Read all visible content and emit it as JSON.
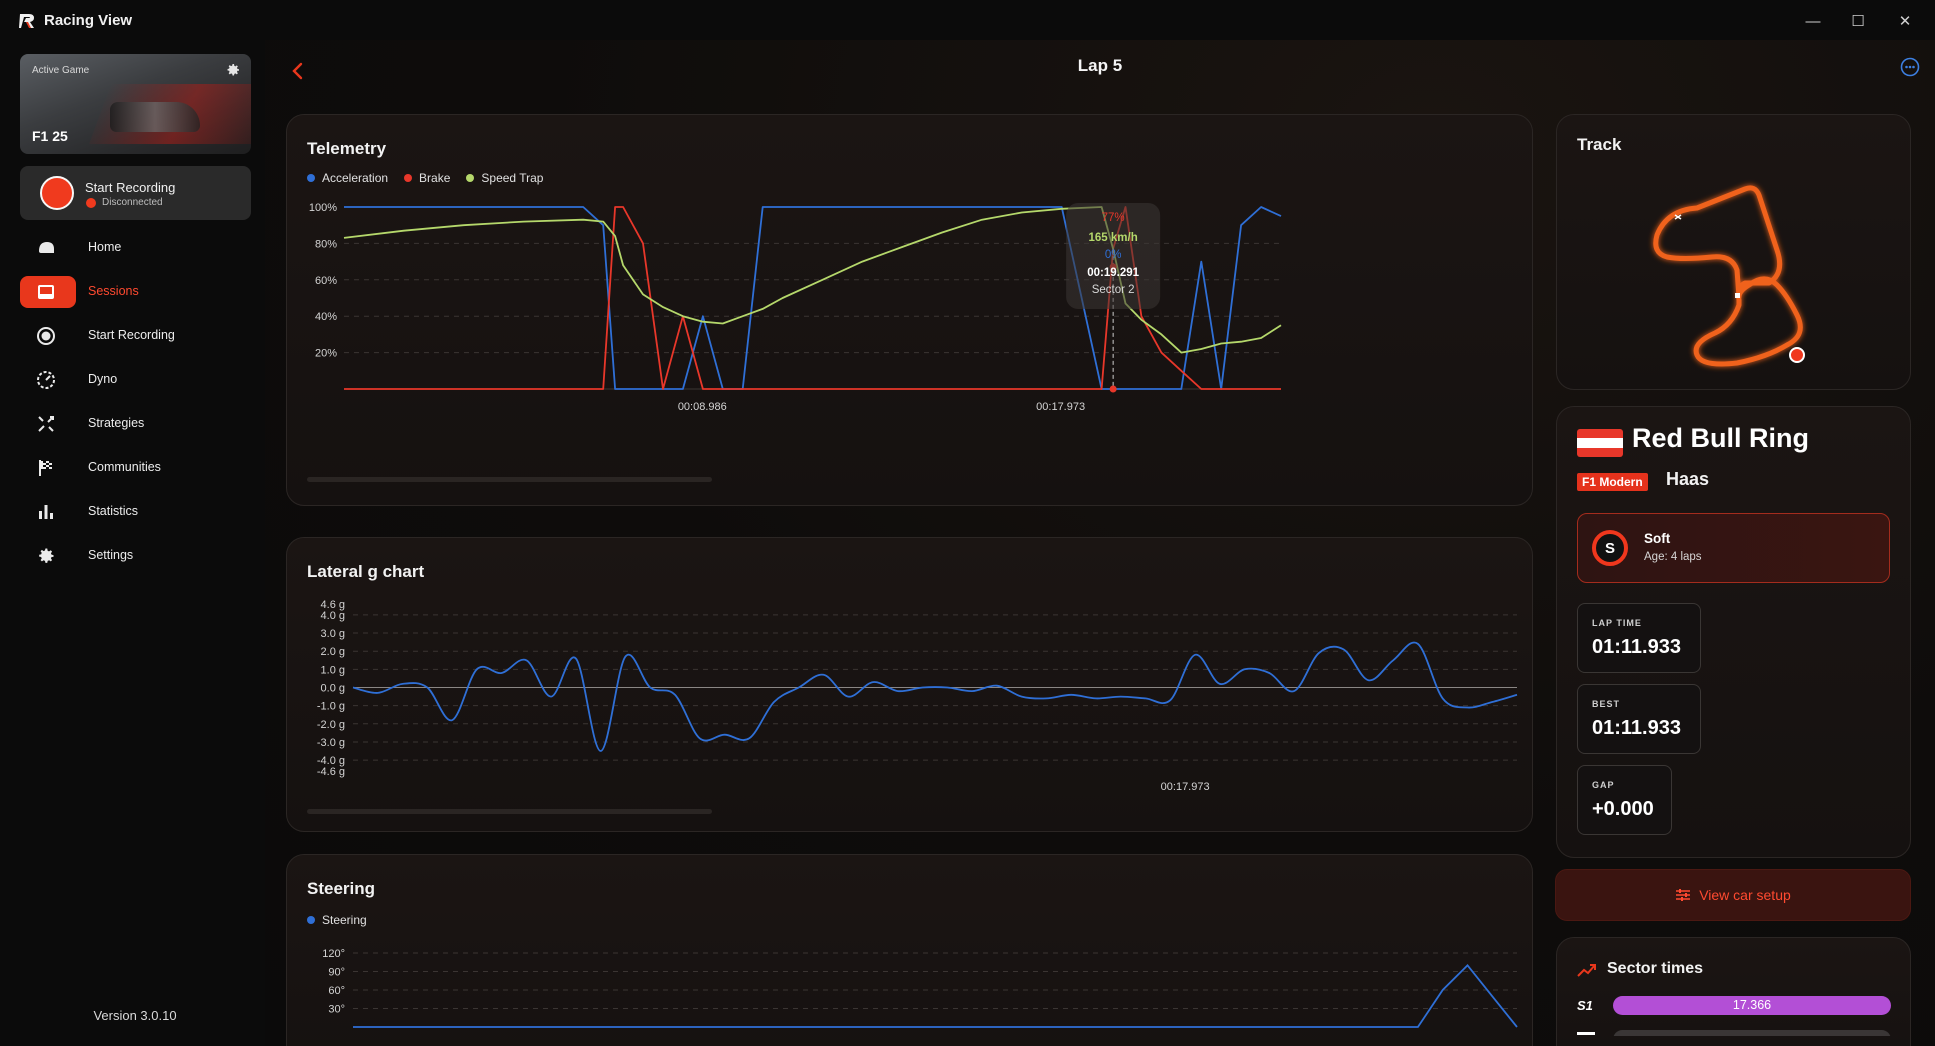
{
  "window": {
    "title": "Racing View",
    "minimize": "—",
    "maximize": "☐",
    "close": "✕"
  },
  "sidebar": {
    "active_game": {
      "label": "Active Game",
      "name": "F1 25"
    },
    "recording": {
      "title": "Start Recording",
      "status": "Disconnected"
    },
    "nav": [
      {
        "label": "Home",
        "icon": "helmet-icon"
      },
      {
        "label": "Sessions",
        "icon": "sessions-icon",
        "active": true
      },
      {
        "label": "Start Recording",
        "icon": "record-icon"
      },
      {
        "label": "Dyno",
        "icon": "dyno-icon"
      },
      {
        "label": "Strategies",
        "icon": "strategies-icon"
      },
      {
        "label": "Communities",
        "icon": "flag-icon"
      },
      {
        "label": "Statistics",
        "icon": "bar-chart-icon"
      },
      {
        "label": "Settings",
        "icon": "gear-icon"
      }
    ],
    "version": "Version 3.0.10"
  },
  "header": {
    "title": "Lap 5"
  },
  "telemetry": {
    "title": "Telemetry",
    "legend": [
      {
        "name": "Acceleration",
        "color": "#2f6fd6"
      },
      {
        "name": "Brake",
        "color": "#e8372a"
      },
      {
        "name": "Speed Trap",
        "color": "#b5d86b"
      }
    ],
    "tooltip": {
      "brake": "77%",
      "speed": "165  km/h",
      "accel": "0%",
      "time": "00:19.291",
      "sector": "Sector 2"
    }
  },
  "lateral": {
    "title": "Lateral g chart"
  },
  "steering": {
    "title": "Steering",
    "legend": [
      {
        "name": "Steering",
        "color": "#2f6fd6"
      }
    ]
  },
  "track": {
    "title": "Track"
  },
  "session": {
    "circuit": "Red Bull Ring",
    "series": "F1 Modern",
    "team": "Haas",
    "tyre": {
      "letter": "S",
      "name": "Soft",
      "age": "Age: 4 laps"
    },
    "lap_time": {
      "label": "LAP TIME",
      "value": "01:11.933"
    },
    "best": {
      "label": "BEST",
      "value": "01:11.933"
    },
    "gap": {
      "label": "GAP",
      "value": "+0.000"
    },
    "setup_button": "View car setup"
  },
  "sectors": {
    "title": "Sector times",
    "rows": [
      {
        "label": "S1",
        "value": "17.366"
      }
    ]
  },
  "chart_data": [
    {
      "type": "line",
      "title": "Telemetry",
      "x_ticks": [
        "00:08.986",
        "00:17.973"
      ],
      "y_ticks": [
        "100%",
        "80%",
        "60%",
        "40%",
        "20%"
      ],
      "ylim": [
        0,
        100
      ],
      "x": [
        0,
        1.5,
        3,
        4.5,
        6,
        6.5,
        6.8,
        7,
        7.5,
        8,
        8.5,
        9,
        9.5,
        10,
        10.5,
        11,
        12,
        13,
        14,
        15,
        16,
        17,
        18,
        19,
        19.29,
        19.6,
        20,
        20.5,
        21,
        21.5,
        22,
        22.5,
        23,
        23.5
      ],
      "series": [
        {
          "name": "Acceleration",
          "values": [
            100,
            100,
            100,
            100,
            100,
            90,
            0,
            0,
            0,
            0,
            0,
            40,
            0,
            0,
            100,
            100,
            100,
            100,
            100,
            100,
            100,
            100,
            100,
            0,
            0,
            0,
            0,
            0,
            0,
            70,
            0,
            90,
            100,
            95
          ]
        },
        {
          "name": "Brake",
          "values": [
            0,
            0,
            0,
            0,
            0,
            0,
            100,
            100,
            80,
            0,
            40,
            0,
            0,
            0,
            0,
            0,
            0,
            0,
            0,
            0,
            0,
            0,
            0,
            0,
            77,
            100,
            40,
            20,
            10,
            0,
            0,
            0,
            0,
            0
          ]
        },
        {
          "name": "Speed Trap",
          "values": [
            83,
            87,
            90,
            92,
            93,
            92,
            84,
            68,
            52,
            45,
            40,
            37,
            36,
            40,
            44,
            50,
            60,
            70,
            78,
            86,
            93,
            97,
            99,
            100,
            77,
            47,
            38,
            30,
            20,
            22,
            25,
            26,
            28,
            35
          ]
        }
      ]
    },
    {
      "type": "line",
      "title": "Lateral g chart",
      "x_ticks": [
        "00:17.973"
      ],
      "y_ticks": [
        "4.6 g",
        "4.0 g",
        "3.0 g",
        "2.0 g",
        "1.0 g",
        "0.0 g",
        "-1.0 g",
        "-2.0 g",
        "-3.0 g",
        "-4.0 g",
        "-4.6 g"
      ],
      "ylim": [
        -4.6,
        4.6
      ],
      "x": [
        0,
        1,
        2,
        3,
        4,
        5,
        6,
        7,
        8,
        9,
        10,
        11,
        12,
        13,
        14,
        15,
        16,
        17,
        18,
        19,
        20,
        21,
        22,
        23,
        24,
        25,
        26,
        27,
        28,
        29,
        30,
        31,
        32,
        33,
        34,
        35,
        36,
        37,
        38,
        39,
        40,
        41,
        42,
        43,
        44,
        45,
        46,
        47
      ],
      "series": [
        {
          "name": "Lateral g",
          "values": [
            0,
            -0.3,
            0.2,
            0,
            -1.8,
            1,
            0.8,
            1.5,
            -0.5,
            1.6,
            -3.5,
            1.7,
            0,
            -0.4,
            -2.8,
            -2.6,
            -2.8,
            -0.8,
            0,
            0.7,
            -0.5,
            0.3,
            -0.2,
            0,
            0,
            -0.2,
            0.1,
            -0.5,
            -0.6,
            -0.4,
            -0.6,
            -0.5,
            -0.6,
            -0.7,
            1.8,
            0.2,
            1,
            0.8,
            -0.2,
            1.9,
            2.1,
            0.4,
            1.5,
            2.4,
            -0.6,
            -1.1,
            -0.8,
            -0.4
          ]
        }
      ]
    },
    {
      "type": "line",
      "title": "Steering",
      "y_ticks": [
        "120°",
        "90°",
        "60°",
        "30°"
      ],
      "ylim": [
        0,
        120
      ],
      "x": [
        0,
        5,
        10,
        15,
        20,
        25,
        30,
        35,
        40,
        43,
        44,
        45,
        46,
        47
      ],
      "series": [
        {
          "name": "Steering",
          "values": [
            0,
            0,
            0,
            0,
            0,
            0,
            0,
            0,
            0,
            0,
            60,
            100,
            50,
            0
          ]
        }
      ]
    }
  ]
}
